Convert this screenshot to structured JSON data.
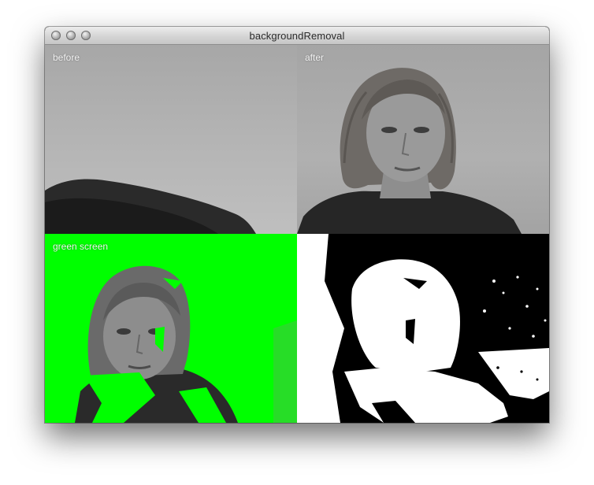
{
  "window": {
    "title": "backgroundRemoval"
  },
  "panels": {
    "before": {
      "label": "before"
    },
    "after": {
      "label": "after"
    },
    "green_screen": {
      "label": "green screen"
    },
    "mask": {
      "label": ""
    }
  },
  "colors": {
    "key_green": "#00ff00",
    "mask_white": "#ffffff",
    "mask_black": "#000000"
  }
}
